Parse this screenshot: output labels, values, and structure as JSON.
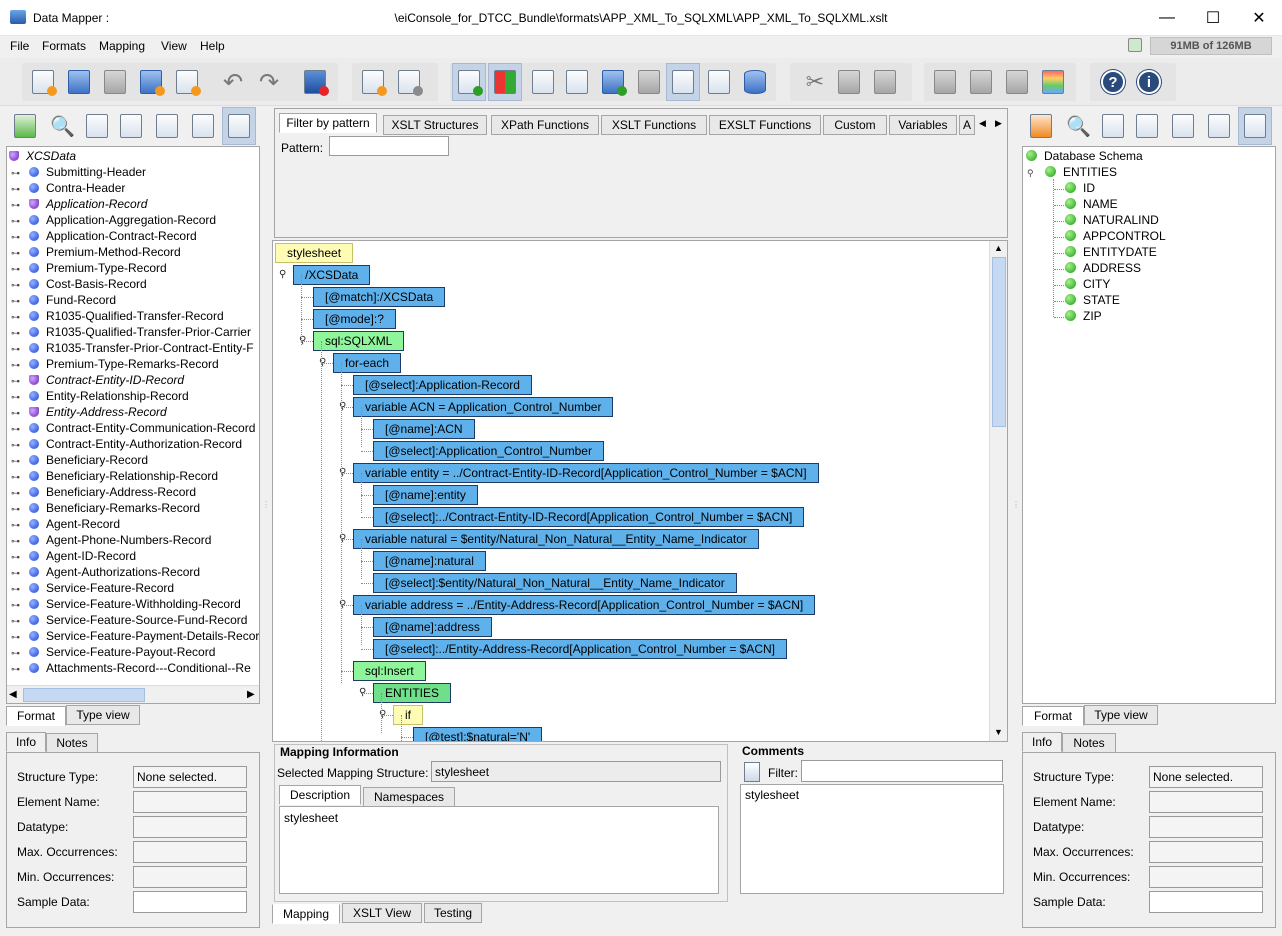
{
  "window": {
    "app_title": "Data Mapper :",
    "path_title": "\\eiConsole_for_DTCC_Bundle\\formats\\APP_XML_To_SQLXML\\APP_XML_To_SQLXML.xslt",
    "minimize": "—",
    "maximize": "☐",
    "close": "✕"
  },
  "menu": [
    "File",
    "Formats",
    "Mapping",
    "View",
    "Help"
  ],
  "memory": "91MB of 126MB",
  "left_tree": {
    "root": "XCSData",
    "items": [
      {
        "label": "Submitting-Header",
        "group": false
      },
      {
        "label": "Contra-Header",
        "group": false
      },
      {
        "label": "Application-Record",
        "group": true
      },
      {
        "label": "Application-Aggregation-Record",
        "group": false
      },
      {
        "label": "Application-Contract-Record",
        "group": false
      },
      {
        "label": "Premium-Method-Record",
        "group": false
      },
      {
        "label": "Premium-Type-Record",
        "group": false
      },
      {
        "label": "Cost-Basis-Record",
        "group": false
      },
      {
        "label": "Fund-Record",
        "group": false
      },
      {
        "label": "R1035-Qualified-Transfer-Record",
        "group": false
      },
      {
        "label": "R1035-Qualified-Transfer-Prior-Carrier",
        "group": false
      },
      {
        "label": "R1035-Transfer-Prior-Contract-Entity-F",
        "group": false
      },
      {
        "label": "Premium-Type-Remarks-Record",
        "group": false
      },
      {
        "label": "Contract-Entity-ID-Record",
        "group": true
      },
      {
        "label": "Entity-Relationship-Record",
        "group": false
      },
      {
        "label": "Entity-Address-Record",
        "group": true
      },
      {
        "label": "Contract-Entity-Communication-Record",
        "group": false
      },
      {
        "label": "Contract-Entity-Authorization-Record",
        "group": false
      },
      {
        "label": "Beneficiary-Record",
        "group": false
      },
      {
        "label": "Beneficiary-Relationship-Record",
        "group": false
      },
      {
        "label": "Beneficiary-Address-Record",
        "group": false
      },
      {
        "label": "Beneficiary-Remarks-Record",
        "group": false
      },
      {
        "label": "Agent-Record",
        "group": false
      },
      {
        "label": "Agent-Phone-Numbers-Record",
        "group": false
      },
      {
        "label": "Agent-ID-Record",
        "group": false
      },
      {
        "label": "Agent-Authorizations-Record",
        "group": false
      },
      {
        "label": "Service-Feature-Record",
        "group": false
      },
      {
        "label": "Service-Feature-Withholding-Record",
        "group": false
      },
      {
        "label": "Service-Feature-Source-Fund-Record",
        "group": false
      },
      {
        "label": "Service-Feature-Payment-Details-Record",
        "group": false
      },
      {
        "label": "Service-Feature-Payout-Record",
        "group": false
      },
      {
        "label": "Attachments-Record---Conditional--Re",
        "group": false
      }
    ]
  },
  "left_tabs": {
    "format": "Format",
    "type_view": "Type view",
    "info": "Info",
    "notes": "Notes"
  },
  "info_fields": {
    "structure_type_label": "Structure Type:",
    "structure_type_value": "None selected.",
    "element_name_label": "Element Name:",
    "datatype_label": "Datatype:",
    "max_occ_label": "Max. Occurrences:",
    "min_occ_label": "Min. Occurrences:",
    "sample_data_label": "Sample Data:"
  },
  "center_tabs": [
    "Filter by pattern",
    "XSLT Structures",
    "XPath Functions",
    "XSLT Functions",
    "EXSLT Functions",
    "Custom",
    "Variables",
    "A"
  ],
  "pattern_label": "Pattern:",
  "mapping_nodes": [
    "stylesheet",
    "/XCSData",
    "[@match]:/XCSData",
    "[@mode]:?",
    "sql:SQLXML",
    "for-each",
    "[@select]:Application-Record",
    "variable ACN = Application_Control_Number",
    "[@name]:ACN",
    "[@select]:Application_Control_Number",
    "variable entity = ../Contract-Entity-ID-Record[Application_Control_Number = $ACN]",
    "[@name]:entity",
    "[@select]:../Contract-Entity-ID-Record[Application_Control_Number = $ACN]",
    "variable natural = $entity/Natural_Non_Natural__Entity_Name_Indicator",
    "[@name]:natural",
    "[@select]:$entity/Natural_Non_Natural__Entity_Name_Indicator",
    "variable address = ../Entity-Address-Record[Application_Control_Number = $ACN]",
    "[@name]:address",
    "[@select]:../Entity-Address-Record[Application_Control_Number = $ACN]",
    "sql:Insert",
    "ENTITIES",
    "if",
    "[@test]:$natural='N'"
  ],
  "mapping_info": {
    "title": "Mapping Information",
    "selected_label": "Selected Mapping Structure:",
    "selected_value": "stylesheet",
    "tab_description": "Description",
    "tab_namespaces": "Namespaces",
    "description_text": "stylesheet"
  },
  "comments": {
    "title": "Comments",
    "filter_label": "Filter:",
    "text": "stylesheet"
  },
  "bottom_tabs": [
    "Mapping",
    "XSLT View",
    "Testing"
  ],
  "right_tree": {
    "root": "Database Schema",
    "entities": "ENTITIES",
    "fields": [
      "ID",
      "NAME",
      "NATURALIND",
      "APPCONTROL",
      "ENTITYDATE",
      "ADDRESS",
      "CITY",
      "STATE",
      "ZIP"
    ]
  },
  "colors": {
    "node_blue": "#5fb1ec",
    "node_green": "#8ef59a",
    "node_yellow": "#fdfbb4",
    "selected_tool": "#c5d3e6"
  }
}
